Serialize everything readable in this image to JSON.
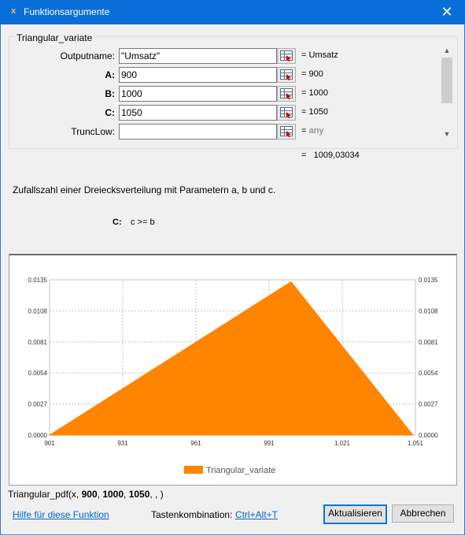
{
  "window": {
    "title": "Funktionsargumente",
    "app_icon": "x",
    "close_glyph": "✕"
  },
  "group": {
    "label": "Triangular_variate"
  },
  "arguments": [
    {
      "label": "Outputname:",
      "value": "\"Umsatz\"",
      "result": "= Umsatz",
      "bold": false
    },
    {
      "label": "A:",
      "value": "900",
      "result": "= 900",
      "bold": true
    },
    {
      "label": "B:",
      "value": "1000",
      "result": "= 1000",
      "bold": true
    },
    {
      "label": "C:",
      "value": "1050",
      "result": "= 1050",
      "bold": true
    },
    {
      "label": "TruncLow:",
      "value": "",
      "result_prefix": "= ",
      "result_any": "any",
      "bold": false
    }
  ],
  "formula_result": "=   1009,03034",
  "description": "Zufallszahl einer Dreiecksverteilung mit Parametern a, b und c.",
  "param_help": {
    "name": "C:",
    "text": "c >= b"
  },
  "chart_data": {
    "type": "area",
    "series": [
      {
        "name": "Triangular_variate",
        "color": "#ff8400",
        "x": [
          900,
          1000,
          1050
        ],
        "y": [
          0,
          0.01333,
          0
        ]
      }
    ],
    "x_ticks": [
      "901",
      "931",
      "961",
      "991",
      "1,021",
      "1,051"
    ],
    "x_tick_values": [
      901,
      931,
      961,
      991,
      1021,
      1051
    ],
    "y_ticks": [
      "0.0000",
      "0.0027",
      "0.0054",
      "0.0081",
      "0.0108",
      "0.0135"
    ],
    "y_tick_values": [
      0,
      0.0027,
      0.0054,
      0.0081,
      0.0108,
      0.0135
    ],
    "xlim": [
      901,
      1051
    ],
    "ylim": [
      0,
      0.0135
    ],
    "grid": true,
    "legend_position": "bottom"
  },
  "formula_text": {
    "prefix": "Triangular_pdf(x, ",
    "a": "900",
    "sep1": ", ",
    "b": "1000",
    "sep2": ", ",
    "c": "1050",
    "suffix": ", , )"
  },
  "footer": {
    "help_link": "Hilfe für diese Funktion",
    "shortcut_label": "Tastenkombination:",
    "shortcut_value": "Ctrl+Alt+T",
    "update_button": "Aktualisieren",
    "cancel_button": "Abbrechen"
  }
}
